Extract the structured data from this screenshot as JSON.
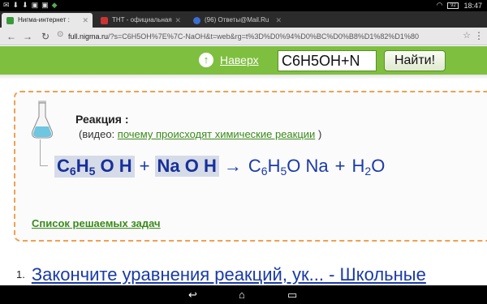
{
  "status": {
    "left_icons": [
      "✉",
      "⬇",
      "⬇",
      "▣",
      "▣",
      "◆"
    ],
    "time": "18:47",
    "battery": "92"
  },
  "tabs": [
    {
      "label": "Нигма-интернет :",
      "active": true,
      "favicon_color": "#3a9a3a"
    },
    {
      "label": "ТНТ - официальная",
      "active": false,
      "favicon_color": "#c33"
    },
    {
      "label": "(96) Ответы@Mail.Ru",
      "active": false,
      "favicon_color": "#3b6ecf"
    }
  ],
  "toolbar": {
    "url_host": "full.nigma.ru",
    "url_rest": "/?s=C6H5OH%7E%7C-NaOH&t=web&rg=t%3D%D0%94%D0%BC%D0%B8%D1%82%D1%80"
  },
  "header": {
    "up_label": "Наверх",
    "query": "C6H5OH+N",
    "find_label": "Найти!"
  },
  "card": {
    "title": "Реакция :",
    "video_prefix": "(видео:",
    "video_link": "почему происходят химические реакции",
    "video_suffix": ")",
    "tasks_link": "Список решаемых задач"
  },
  "equation": {
    "c": "C",
    "c_sub": "6",
    "h": "H",
    "h_sub": "5",
    "o": "O",
    "h2": "H",
    "plus": "+",
    "na": "Na",
    "o2": "O",
    "h3": "H",
    "arrow": "→",
    "p_c": "C",
    "p_c_sub": "6",
    "p_h": "H",
    "p_h_sub": "5",
    "p_o": "O",
    "p_na": "Na",
    "plus2": "+",
    "p_h2": "H",
    "p_h2_sub": "2",
    "p_o2": "O"
  },
  "result": {
    "number": "1.",
    "title": "Закончите уравнения реакций, ук... - Школьные"
  }
}
